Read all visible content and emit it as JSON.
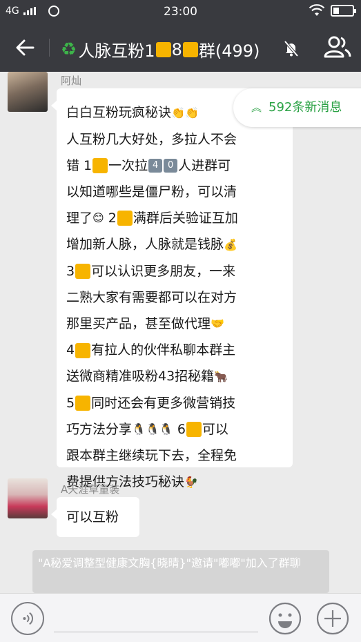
{
  "status_bar": {
    "network": "4G",
    "time": "23:00"
  },
  "header": {
    "title_prefix": "人脉互粉1",
    "title_mid": "8",
    "title_suffix": "群(499)"
  },
  "new_messages": {
    "label": "592条新消息"
  },
  "messages": [
    {
      "sender": "阿灿",
      "lines": [
        {
          "a": "白白互粉玩疯秘诀"
        },
        {
          "a": "人互粉几大好处，多拉人不会"
        },
        {
          "a": "错 1",
          "b": "一次拉",
          "k1": "4",
          "k2": "0",
          "c": "人进群可"
        },
        {
          "a": "以知道哪些是僵尸粉，可以清"
        },
        {
          "a": "理了",
          "b": " 2",
          "c": "满群后关验证互加"
        },
        {
          "a": "增加新人脉，人脉就是钱脉"
        },
        {
          "a": "3",
          "b": "可以认识更多朋友，一来"
        },
        {
          "a": "二熟大家有需要都可以在对方"
        },
        {
          "a": "那里买产品，甚至做代理"
        },
        {
          "a": "4",
          "b": "有拉人的伙伴私聊本群主"
        },
        {
          "a": "送微商精准吸粉43招秘籍"
        },
        {
          "a": "5",
          "b": "同时还会有更多微营销技"
        },
        {
          "a": "巧方法分享",
          "b": " 6",
          "c": "可以"
        },
        {
          "a": "跟本群主继续玩下去，全程免"
        },
        {
          "a": "费提供方法技巧秘诀"
        }
      ]
    },
    {
      "sender": "A天涯草童装",
      "text": "可以互粉"
    }
  ],
  "system_notice": "\"A秘爱调整型健康文胸{晓晴}\"邀请\"嘟嘟\"加入了群聊",
  "colors": {
    "bar": "#393a3f",
    "chat_bg": "#ebebeb",
    "accent_green": "#2ba245",
    "number_square": "#f7b400"
  },
  "icons": [
    "back-arrow-icon",
    "recycle-icon",
    "mute-bell-icon",
    "group-members-icon",
    "double-chevron-up-icon",
    "voice-icon",
    "emoji-icon",
    "plus-icon"
  ]
}
